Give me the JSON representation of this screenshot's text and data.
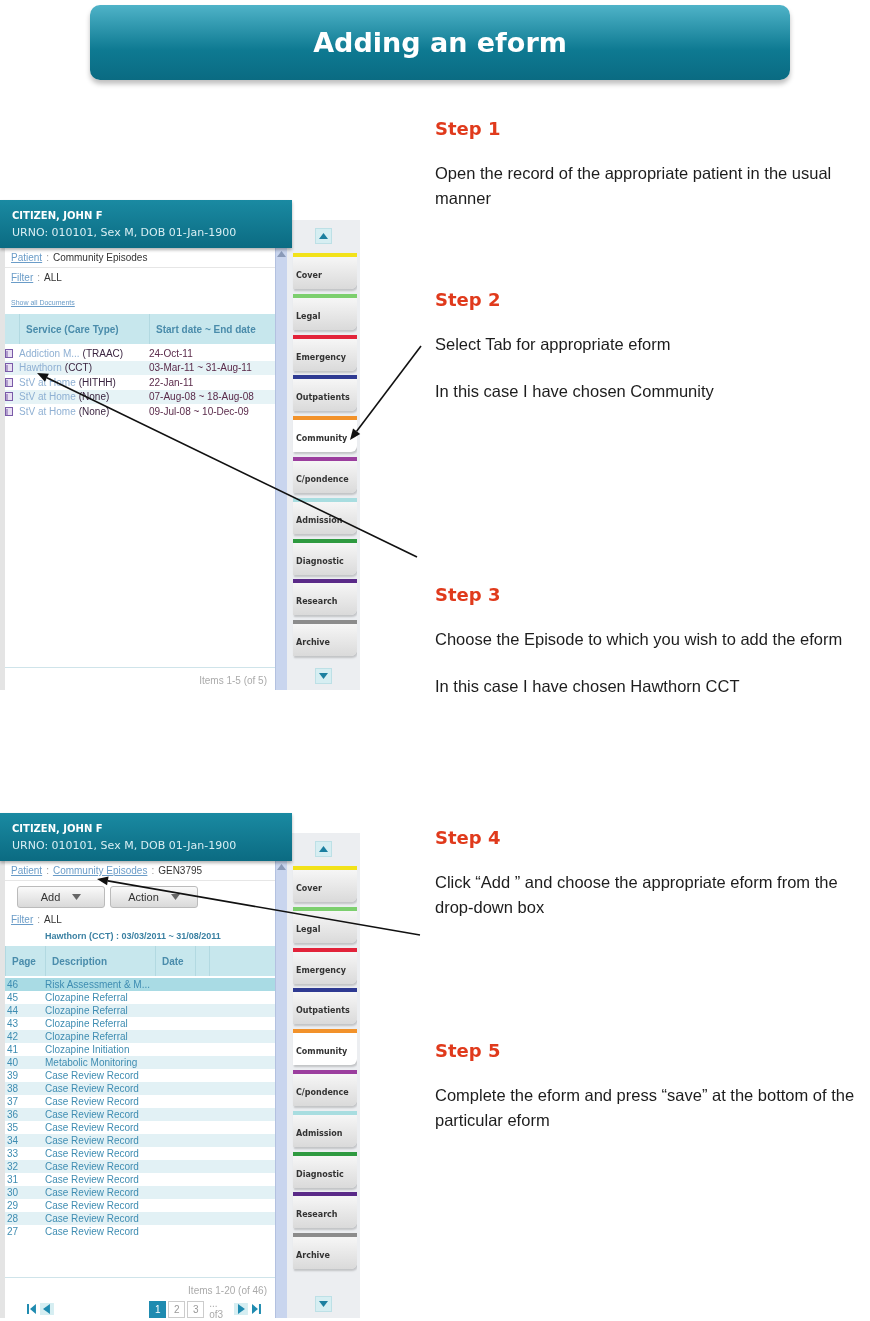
{
  "banner": {
    "title": "Adding an eform"
  },
  "sections": [
    {
      "screen": {
        "kind": "episodes",
        "patient_name": "CITIZEN, JOHN F",
        "patient_details": "URNO: 010101, Sex  M,  DOB 01-Jan-1900",
        "breadcrumb": [
          {
            "text": "Patient",
            "link": true
          },
          {
            "text": "Community Episodes",
            "link": false
          }
        ],
        "separator": ":",
        "filter": {
          "label": "Filter",
          "separator": ":",
          "value": "ALL"
        },
        "show_all": "Show all Documents",
        "columns": [
          "Service (Care Type)",
          "Start date ~ End date"
        ],
        "rows": [
          {
            "service": "Addiction M...",
            "care_type": "(TRAAC)",
            "dates": "24-Oct-11"
          },
          {
            "service": "Hawthorn",
            "care_type": "(CCT)",
            "dates": "03-Mar-11 ~ 31-Aug-11"
          },
          {
            "service": "StV at Home",
            "care_type": "(HITHH)",
            "dates": "22-Jan-11"
          },
          {
            "service": "StV at Home",
            "care_type": "(None)",
            "dates": "07-Aug-08 ~ 18-Aug-08"
          },
          {
            "service": "StV at Home",
            "care_type": "(None)",
            "dates": "09-Jul-08 ~ 10-Dec-09"
          }
        ],
        "items": "Items 1-5 (of 5)",
        "tabs": [
          {
            "label": "Cover",
            "color": "#f2e21a",
            "selected": false
          },
          {
            "label": "Legal",
            "color": "#7ccf6e",
            "selected": false
          },
          {
            "label": "Emergency",
            "color": "#e2233a",
            "selected": false
          },
          {
            "label": "Outpatients",
            "color": "#2e3a92",
            "selected": false
          },
          {
            "label": "Community",
            "color": "#f2922a",
            "selected": true
          },
          {
            "label": "C/pondence",
            "color": "#9b3e9e",
            "selected": false
          },
          {
            "label": "Admission",
            "color": "#a8dde0",
            "selected": false
          },
          {
            "label": "Diagnostic",
            "color": "#2e9a40",
            "selected": false
          },
          {
            "label": "Research",
            "color": "#5a2a88",
            "selected": false
          },
          {
            "label": "Archive",
            "color": "#8c8c8c",
            "selected": false
          }
        ]
      },
      "steps": [
        {
          "title": "Step 1",
          "paragraphs": [
            "Open the record of the appropriate patient in the usual manner"
          ]
        },
        {
          "title": "Step 2",
          "paragraphs": [
            "Select Tab for appropriate eform",
            "In this case I have chosen Community"
          ]
        },
        {
          "title": "Step 3",
          "paragraphs": [
            "Choose the Episode to which you wish to add the eform",
            "In this case I have chosen Hawthorn CCT"
          ]
        }
      ]
    },
    {
      "screen": {
        "kind": "documents",
        "patient_name": "CITIZEN, JOHN F",
        "patient_details": "URNO: 010101, Sex  M,  DOB 01-Jan-1900",
        "breadcrumb": [
          {
            "text": "Patient",
            "link": true
          },
          {
            "text": "Community Episodes",
            "link": true
          },
          {
            "text": "GEN3795",
            "link": false
          }
        ],
        "separator": ":",
        "buttons": [
          "Add",
          "Action"
        ],
        "filter": {
          "label": "Filter",
          "separator": ":",
          "value": "ALL"
        },
        "episode_heading": "Hawthorn (CCT) : 03/03/2011 ~ 31/08/2011",
        "columns": [
          "Page",
          "Description",
          "Date"
        ],
        "rows": [
          {
            "page": "46",
            "description": "Risk Assessment & M...",
            "selected": true
          },
          {
            "page": "45",
            "description": "Clozapine Referral",
            "selected": false
          },
          {
            "page": "44",
            "description": "Clozapine Referral",
            "selected": false
          },
          {
            "page": "43",
            "description": "Clozapine Referral",
            "selected": false
          },
          {
            "page": "42",
            "description": "Clozapine Referral",
            "selected": false
          },
          {
            "page": "41",
            "description": "Clozapine Initiation",
            "selected": false
          },
          {
            "page": "40",
            "description": "Metabolic Monitoring",
            "selected": false
          },
          {
            "page": "39",
            "description": "Case Review Record",
            "selected": false
          },
          {
            "page": "38",
            "description": "Case Review Record",
            "selected": false
          },
          {
            "page": "37",
            "description": "Case Review Record",
            "selected": false
          },
          {
            "page": "36",
            "description": "Case Review Record",
            "selected": false
          },
          {
            "page": "35",
            "description": "Case Review Record",
            "selected": false
          },
          {
            "page": "34",
            "description": "Case Review Record",
            "selected": false
          },
          {
            "page": "33",
            "description": "Case Review Record",
            "selected": false
          },
          {
            "page": "32",
            "description": "Case Review Record",
            "selected": false
          },
          {
            "page": "31",
            "description": "Case Review Record",
            "selected": false
          },
          {
            "page": "30",
            "description": "Case Review Record",
            "selected": false
          },
          {
            "page": "29",
            "description": "Case Review Record",
            "selected": false
          },
          {
            "page": "28",
            "description": "Case Review Record",
            "selected": false
          },
          {
            "page": "27",
            "description": "Case Review Record",
            "selected": false
          }
        ],
        "items": "Items 1-20 (of 46)",
        "pager": {
          "pages": [
            {
              "label": "1",
              "selected": true
            },
            {
              "label": "2",
              "selected": false
            },
            {
              "label": "3",
              "selected": false
            }
          ],
          "more": "... of3"
        },
        "tabs": [
          {
            "label": "Cover",
            "color": "#f2e21a",
            "selected": false
          },
          {
            "label": "Legal",
            "color": "#7ccf6e",
            "selected": false
          },
          {
            "label": "Emergency",
            "color": "#e2233a",
            "selected": false
          },
          {
            "label": "Outpatients",
            "color": "#2e3a92",
            "selected": false
          },
          {
            "label": "Community",
            "color": "#f2922a",
            "selected": true
          },
          {
            "label": "C/pondence",
            "color": "#9b3e9e",
            "selected": false
          },
          {
            "label": "Admission",
            "color": "#a8dde0",
            "selected": false
          },
          {
            "label": "Diagnostic",
            "color": "#2e9a40",
            "selected": false
          },
          {
            "label": "Research",
            "color": "#5a2a88",
            "selected": false
          },
          {
            "label": "Archive",
            "color": "#8c8c8c",
            "selected": false
          }
        ]
      },
      "steps": [
        {
          "title": "Step 4",
          "paragraphs": [
            "Click “Add ” and choose the appropriate eform from the drop-down box"
          ]
        },
        {
          "title": "Step 5",
          "paragraphs": [
            "Complete the eform and press “save” at the bottom of the particular eform"
          ]
        }
      ]
    }
  ]
}
